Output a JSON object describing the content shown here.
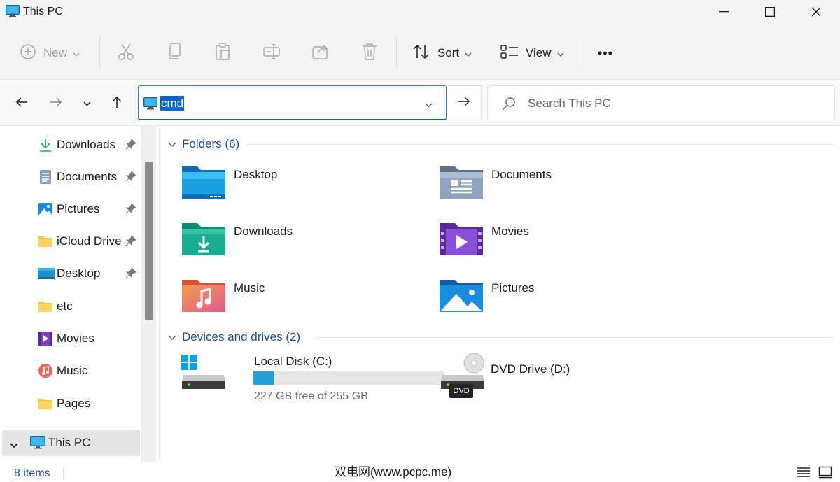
{
  "window": {
    "title": "This PC"
  },
  "toolbar": {
    "new_label": "New",
    "sort_label": "Sort",
    "view_label": "View",
    "more_label": "•••"
  },
  "address": {
    "value": "cmd"
  },
  "search": {
    "placeholder": "Search This PC"
  },
  "sidebar": {
    "items": [
      {
        "label": "Downloads",
        "icon": "download-icon",
        "pinned": true
      },
      {
        "label": "Documents",
        "icon": "documents-icon",
        "pinned": true
      },
      {
        "label": "Pictures",
        "icon": "pictures-icon",
        "pinned": true
      },
      {
        "label": "iCloud Drive",
        "icon": "folder-icon",
        "pinned": true
      },
      {
        "label": "Desktop",
        "icon": "desktop-icon",
        "pinned": true
      },
      {
        "label": "etc",
        "icon": "folder-icon",
        "pinned": false
      },
      {
        "label": "Movies",
        "icon": "movies-icon",
        "pinned": false
      },
      {
        "label": "Music",
        "icon": "music-icon",
        "pinned": false
      },
      {
        "label": "Pages",
        "icon": "folder-icon",
        "pinned": false
      },
      {
        "label": "This PC",
        "icon": "this-pc-icon",
        "pinned": false,
        "selected": true
      }
    ]
  },
  "folders": {
    "header": "Folders (6)",
    "items": [
      {
        "name": "Desktop",
        "icon": "desktop-folder-icon"
      },
      {
        "name": "Documents",
        "icon": "documents-folder-icon"
      },
      {
        "name": "Downloads",
        "icon": "downloads-folder-icon"
      },
      {
        "name": "Movies",
        "icon": "movies-folder-icon"
      },
      {
        "name": "Music",
        "icon": "music-folder-icon"
      },
      {
        "name": "Pictures",
        "icon": "pictures-folder-icon"
      }
    ]
  },
  "drives": {
    "header": "Devices and drives (2)",
    "items": [
      {
        "name": "Local Disk (C:)",
        "free_text": "227 GB free of 255 GB",
        "used_fraction": 0.11,
        "icon": "hard-drive-icon"
      },
      {
        "name": "DVD Drive (D:)",
        "badge": "DVD",
        "icon": "dvd-drive-icon"
      }
    ]
  },
  "status": {
    "items_count": "8 items",
    "watermark": "双电网(www.pcpc.me)"
  },
  "colors": {
    "accent": "#005fb8",
    "link": "#1b4f9c",
    "progress": "#26a0da",
    "selection": "#0b67c9"
  }
}
